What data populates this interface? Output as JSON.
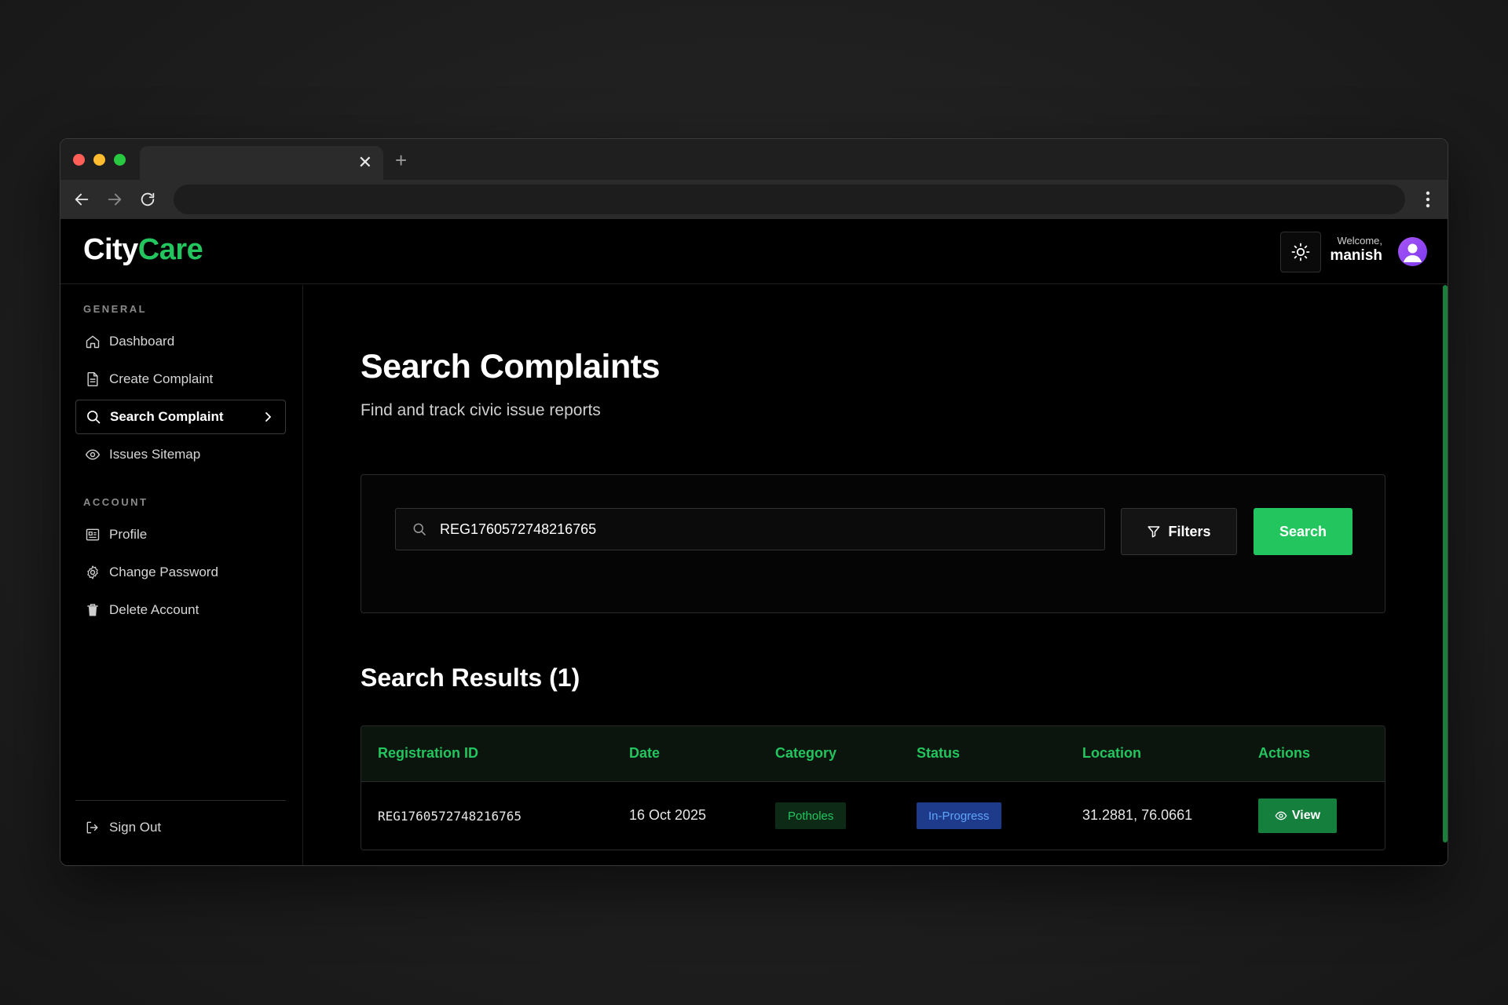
{
  "colors": {
    "accent": "#22c55e",
    "status_blue": "#1e3a8a",
    "background": "#000000"
  },
  "browser": {
    "tab_close": "✕",
    "new_tab": "+"
  },
  "app": {
    "logo_primary": "City",
    "logo_accent": "Care",
    "welcome_label": "Welcome,",
    "username": "manish"
  },
  "sidebar": {
    "general_label": "GENERAL",
    "general_items": [
      {
        "label": "Dashboard",
        "icon": "home-icon"
      },
      {
        "label": "Create Complaint",
        "icon": "document-icon"
      },
      {
        "label": "Search Complaint",
        "icon": "search-icon",
        "active": true
      },
      {
        "label": "Issues Sitemap",
        "icon": "eye-icon"
      }
    ],
    "account_label": "ACCOUNT",
    "account_items": [
      {
        "label": "Profile",
        "icon": "profile-card-icon"
      },
      {
        "label": "Change Password",
        "icon": "gear-icon"
      },
      {
        "label": "Delete Account",
        "icon": "trash-icon"
      }
    ],
    "sign_out": "Sign Out"
  },
  "main": {
    "title": "Search Complaints",
    "subtitle": "Find and track civic issue reports",
    "search": {
      "value": "REG1760572748216765",
      "filters_label": "Filters",
      "search_label": "Search"
    },
    "results_title": "Search Results (1)",
    "table": {
      "headers": [
        "Registration ID",
        "Date",
        "Category",
        "Status",
        "Location",
        "Actions"
      ],
      "rows": [
        {
          "registration_id": "REG1760572748216765",
          "date": "16 Oct 2025",
          "category": "Potholes",
          "status": "In-Progress",
          "location": "31.2881, 76.0661",
          "action": "View"
        }
      ]
    }
  }
}
